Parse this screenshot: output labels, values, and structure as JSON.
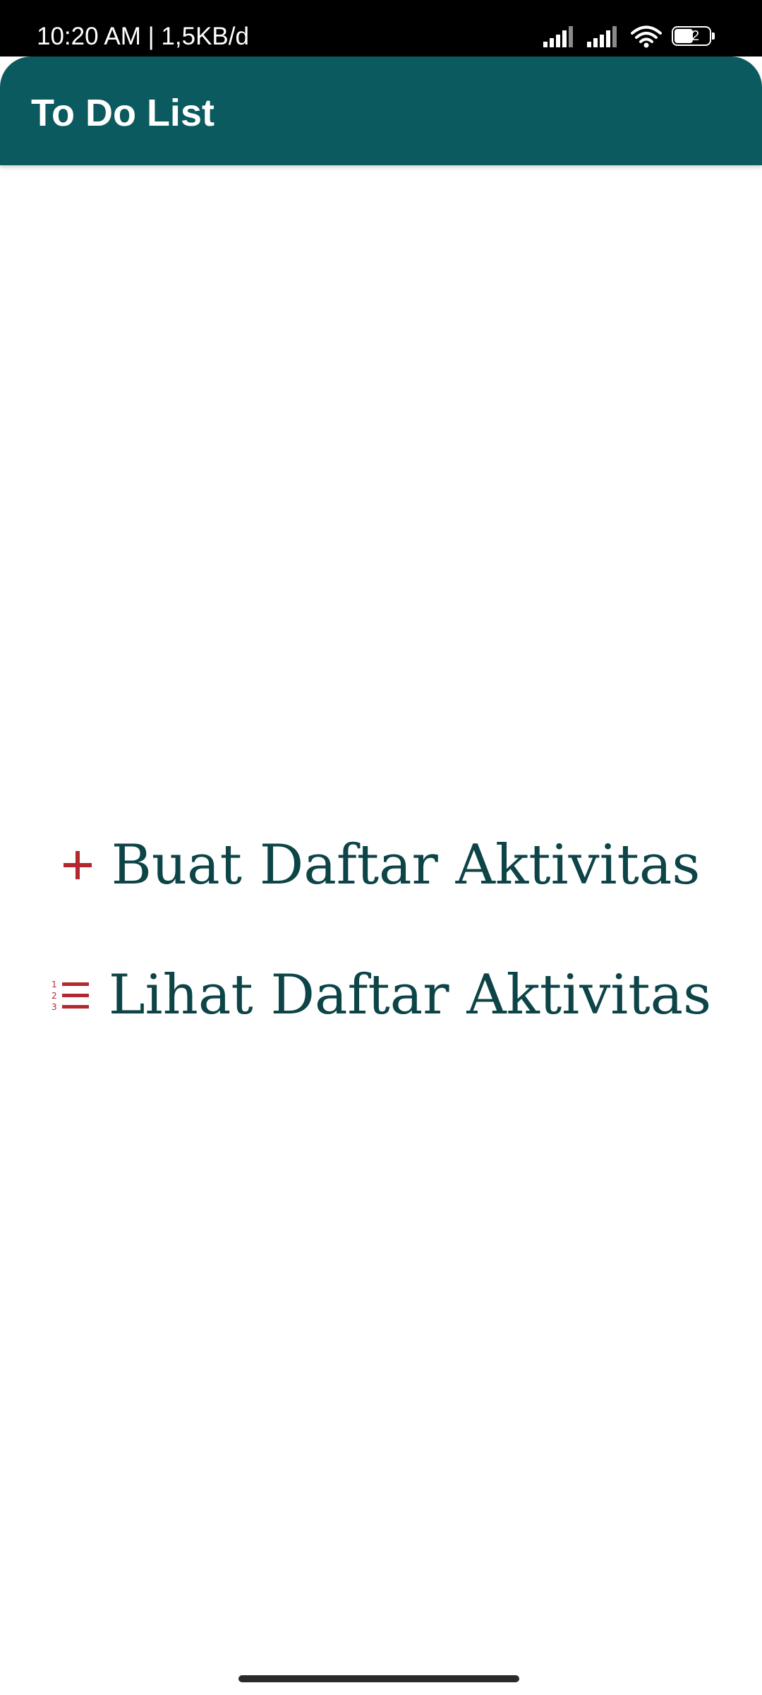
{
  "status_bar": {
    "time_text": "10:20 AM | 1,5KB/d",
    "battery_level": "52",
    "icons": [
      "signal-icon",
      "signal-icon",
      "wifi-icon",
      "battery-icon"
    ]
  },
  "app_bar": {
    "title": "To Do List",
    "background_color": "#0b5a5f"
  },
  "menu": {
    "items": [
      {
        "label": "Buat Daftar Aktivitas",
        "icon": "plus-icon"
      },
      {
        "label": "Lihat Daftar Aktivitas",
        "icon": "numbered-list-icon"
      }
    ],
    "icon_color": "#b3282d",
    "label_color": "#0d4447"
  }
}
